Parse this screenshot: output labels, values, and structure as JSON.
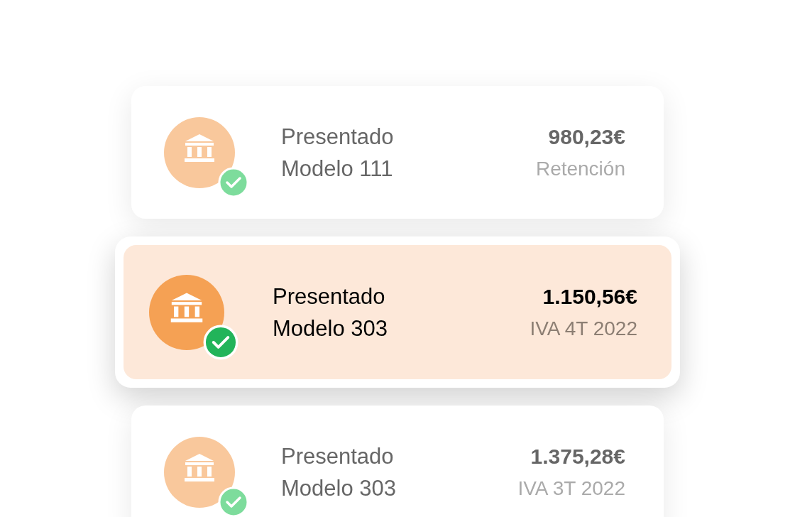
{
  "filings": [
    {
      "status": "Presentado",
      "form": "Modelo 111",
      "amount": "980,23€",
      "detail": "Retención",
      "selected": false
    },
    {
      "status": "Presentado",
      "form": "Modelo 303",
      "amount": "1.150,56€",
      "detail": "IVA 4T 2022",
      "selected": true
    },
    {
      "status": "Presentado",
      "form": "Modelo 303",
      "amount": "1.375,28€",
      "detail": "IVA 3T 2022",
      "selected": false
    }
  ]
}
